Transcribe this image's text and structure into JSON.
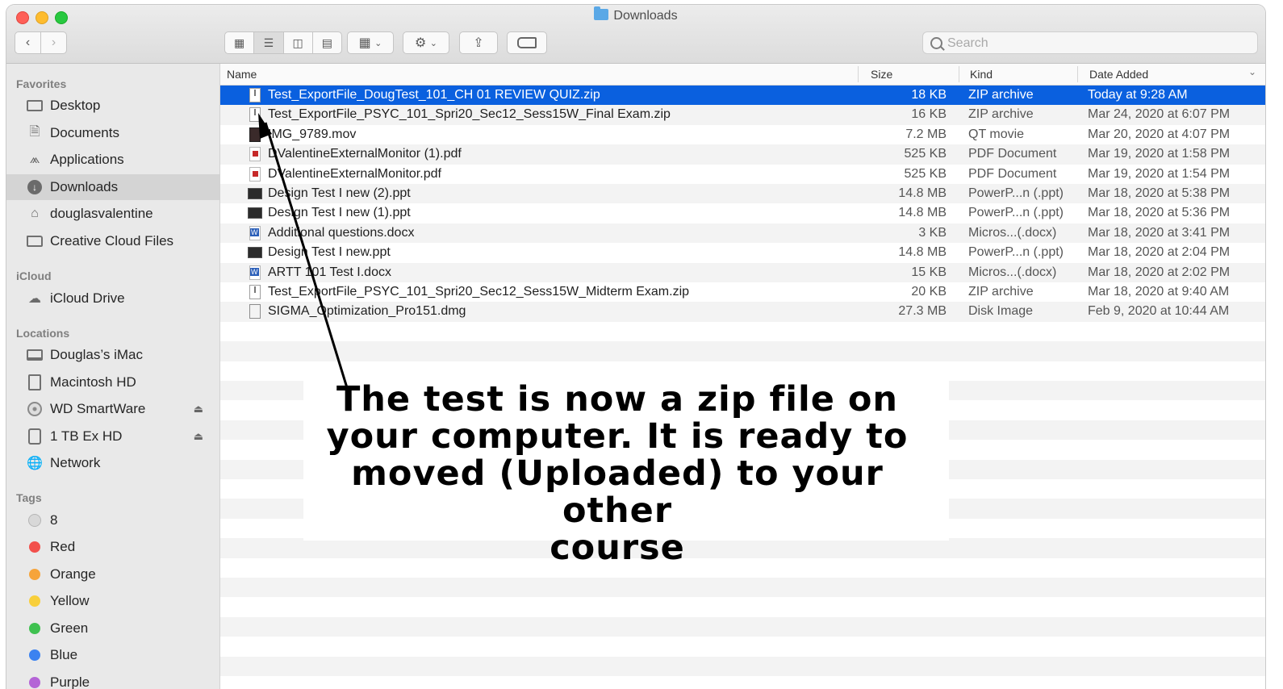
{
  "window": {
    "title": "Downloads"
  },
  "toolbar": {
    "back_icon": "chevron-left-icon",
    "forward_icon": "chevron-right-icon",
    "views": [
      "icon-view",
      "list-view",
      "column-view",
      "gallery-view"
    ],
    "active_view": "list-view",
    "search_placeholder": "Search"
  },
  "sidebar": {
    "favorites_label": "Favorites",
    "favorites": [
      {
        "label": "Desktop",
        "icon": "desktop-icon"
      },
      {
        "label": "Documents",
        "icon": "documents-icon"
      },
      {
        "label": "Applications",
        "icon": "applications-icon"
      },
      {
        "label": "Downloads",
        "icon": "downloads-icon",
        "selected": true
      },
      {
        "label": "douglasvalentine",
        "icon": "home-icon"
      },
      {
        "label": "Creative Cloud Files",
        "icon": "folder-icon"
      }
    ],
    "icloud_label": "iCloud",
    "icloud": [
      {
        "label": "iCloud Drive",
        "icon": "cloud-icon"
      }
    ],
    "locations_label": "Locations",
    "locations": [
      {
        "label": "Douglas’s iMac",
        "icon": "imac-icon"
      },
      {
        "label": "Macintosh HD",
        "icon": "hard-drive-icon"
      },
      {
        "label": "WD SmartWare",
        "icon": "disc-icon",
        "eject": true
      },
      {
        "label": "1 TB Ex HD",
        "icon": "external-drive-icon",
        "eject": true
      },
      {
        "label": "Network",
        "icon": "network-icon"
      }
    ],
    "tags_label": "Tags",
    "tags": [
      {
        "label": "8",
        "color": "#d8d8d8"
      },
      {
        "label": "Red",
        "color": "#f2504c"
      },
      {
        "label": "Orange",
        "color": "#f6a43a"
      },
      {
        "label": "Yellow",
        "color": "#f8cf3b"
      },
      {
        "label": "Green",
        "color": "#3fc150"
      },
      {
        "label": "Blue",
        "color": "#3b82f0"
      },
      {
        "label": "Purple",
        "color": "#b464d6"
      }
    ]
  },
  "columns": {
    "name": "Name",
    "size": "Size",
    "kind": "Kind",
    "date_added": "Date Added"
  },
  "files": [
    {
      "name": "Test_ExportFile_DougTest_101_CH 01 REVIEW QUIZ.zip",
      "size": "18 KB",
      "kind": "ZIP archive",
      "date": "Today at 9:28 AM",
      "type": "zip",
      "selected": true
    },
    {
      "name": "Test_ExportFile_PSYC_101_Spri20_Sec12_Sess15W_Final Exam.zip",
      "size": "16 KB",
      "kind": "ZIP archive",
      "date": "Mar 24, 2020 at 6:07 PM",
      "type": "zip"
    },
    {
      "name": "IMG_9789.mov",
      "size": "7.2 MB",
      "kind": "QT movie",
      "date": "Mar 20, 2020 at 4:07 PM",
      "type": "mov"
    },
    {
      "name": "DValentineExternalMonitor (1).pdf",
      "size": "525 KB",
      "kind": "PDF Document",
      "date": "Mar 19, 2020 at 1:58 PM",
      "type": "pdf"
    },
    {
      "name": "DValentineExternalMonitor.pdf",
      "size": "525 KB",
      "kind": "PDF Document",
      "date": "Mar 19, 2020 at 1:54 PM",
      "type": "pdf"
    },
    {
      "name": "Design Test I new (2).ppt",
      "size": "14.8 MB",
      "kind": "PowerP...n (.ppt)",
      "date": "Mar 18, 2020 at 5:38 PM",
      "type": "ppt"
    },
    {
      "name": "Design Test I new (1).ppt",
      "size": "14.8 MB",
      "kind": "PowerP...n (.ppt)",
      "date": "Mar 18, 2020 at 5:36 PM",
      "type": "ppt"
    },
    {
      "name": "Additional questions.docx",
      "size": "3 KB",
      "kind": "Micros...(.docx)",
      "date": "Mar 18, 2020 at 3:41 PM",
      "type": "docx"
    },
    {
      "name": "Design Test I new.ppt",
      "size": "14.8 MB",
      "kind": "PowerP...n (.ppt)",
      "date": "Mar 18, 2020 at 2:04 PM",
      "type": "ppt"
    },
    {
      "name": "ARTT 101 Test I.docx",
      "size": "15 KB",
      "kind": "Micros...(.docx)",
      "date": "Mar 18, 2020 at 2:02 PM",
      "type": "docx"
    },
    {
      "name": "Test_ExportFile_PSYC_101_Spri20_Sec12_Sess15W_Midterm Exam.zip",
      "size": "20 KB",
      "kind": "ZIP archive",
      "date": "Mar 18, 2020 at 9:40 AM",
      "type": "zip"
    },
    {
      "name": "SIGMA_Optimization_Pro151.dmg",
      "size": "27.3 MB",
      "kind": "Disk Image",
      "date": "Feb 9, 2020 at 10:44 AM",
      "type": "dmg"
    }
  ],
  "annotation": {
    "lines": [
      "The test is now a zip file on",
      "your computer. It is ready to",
      "moved (Uploaded) to your other",
      "course"
    ]
  }
}
